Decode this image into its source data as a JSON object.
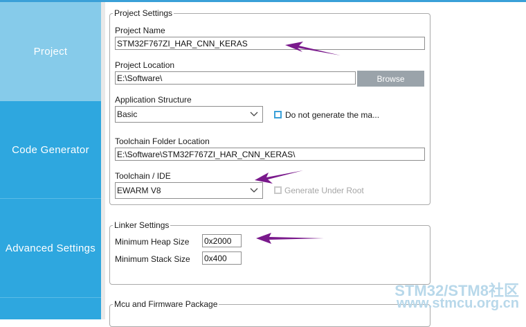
{
  "sidebar": {
    "items": [
      {
        "label": "Project"
      },
      {
        "label": "Code Generator"
      },
      {
        "label": "Advanced Settings"
      }
    ]
  },
  "project_settings": {
    "legend": "Project Settings",
    "project_name_label": "Project Name",
    "project_name_value": "STM32F767ZI_HAR_CNN_KERAS",
    "project_location_label": "Project Location",
    "project_location_value": "E:\\Software\\",
    "browse_label": "Browse",
    "app_structure_label": "Application Structure",
    "app_structure_value": "Basic",
    "do_not_generate_label": "Do not generate the ma...",
    "toolchain_folder_label": "Toolchain Folder Location",
    "toolchain_folder_value": "E:\\Software\\STM32F767ZI_HAR_CNN_KERAS\\",
    "toolchain_ide_label": "Toolchain / IDE",
    "toolchain_ide_value": "EWARM V8",
    "generate_under_root_label": "Generate Under Root"
  },
  "linker_settings": {
    "legend": "Linker Settings",
    "min_heap_label": "Minimum Heap Size",
    "min_heap_value": "0x2000",
    "min_stack_label": "Minimum Stack Size",
    "min_stack_value": "0x400"
  },
  "mcu_firmware": {
    "legend": "Mcu and Firmware Package"
  },
  "watermark": {
    "line1": "STM32/STM8社区",
    "line2": "www.stmcu.org.cn"
  },
  "colors": {
    "sidebar_active": "#86cbea",
    "sidebar_normal": "#2ea7df",
    "checkbox_accent": "#3aa0d8",
    "annotation_arrow": "#7a1a8c",
    "browse_button": "#9aa3aa"
  }
}
